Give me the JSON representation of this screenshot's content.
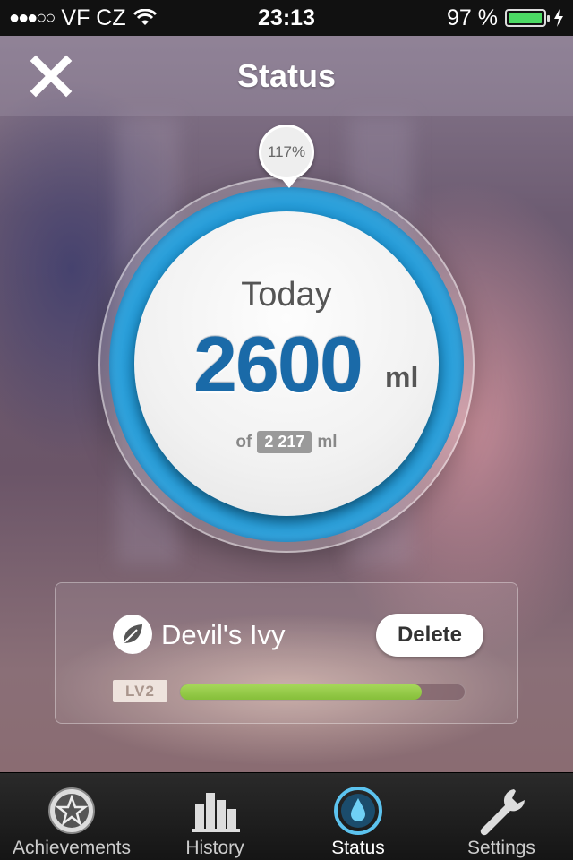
{
  "status_bar": {
    "signal": "●●●○○",
    "carrier": "VF CZ",
    "time": "23:13",
    "battery": "97 %",
    "battery_level": 0.97
  },
  "nav": {
    "title": "Status"
  },
  "gauge": {
    "percent": "117%",
    "label": "Today",
    "amount": "2600",
    "unit": "ml",
    "goal_prefix": "of",
    "goal": "2 217",
    "goal_unit": "ml"
  },
  "plant": {
    "name": "Devil's Ivy",
    "delete_label": "Delete",
    "level": "LV2",
    "progress": 0.85
  },
  "tabs": [
    {
      "label": "Achievements",
      "icon": "star-icon"
    },
    {
      "label": "History",
      "icon": "bar-chart-icon"
    },
    {
      "label": "Status",
      "icon": "water-drop-icon"
    },
    {
      "label": "Settings",
      "icon": "wrench-icon"
    }
  ],
  "colors": {
    "ring_blue": "#1d95d4",
    "amount_blue": "#1a6aa8",
    "progress_green": "#86bf3a",
    "battery_green": "#4cd964"
  }
}
